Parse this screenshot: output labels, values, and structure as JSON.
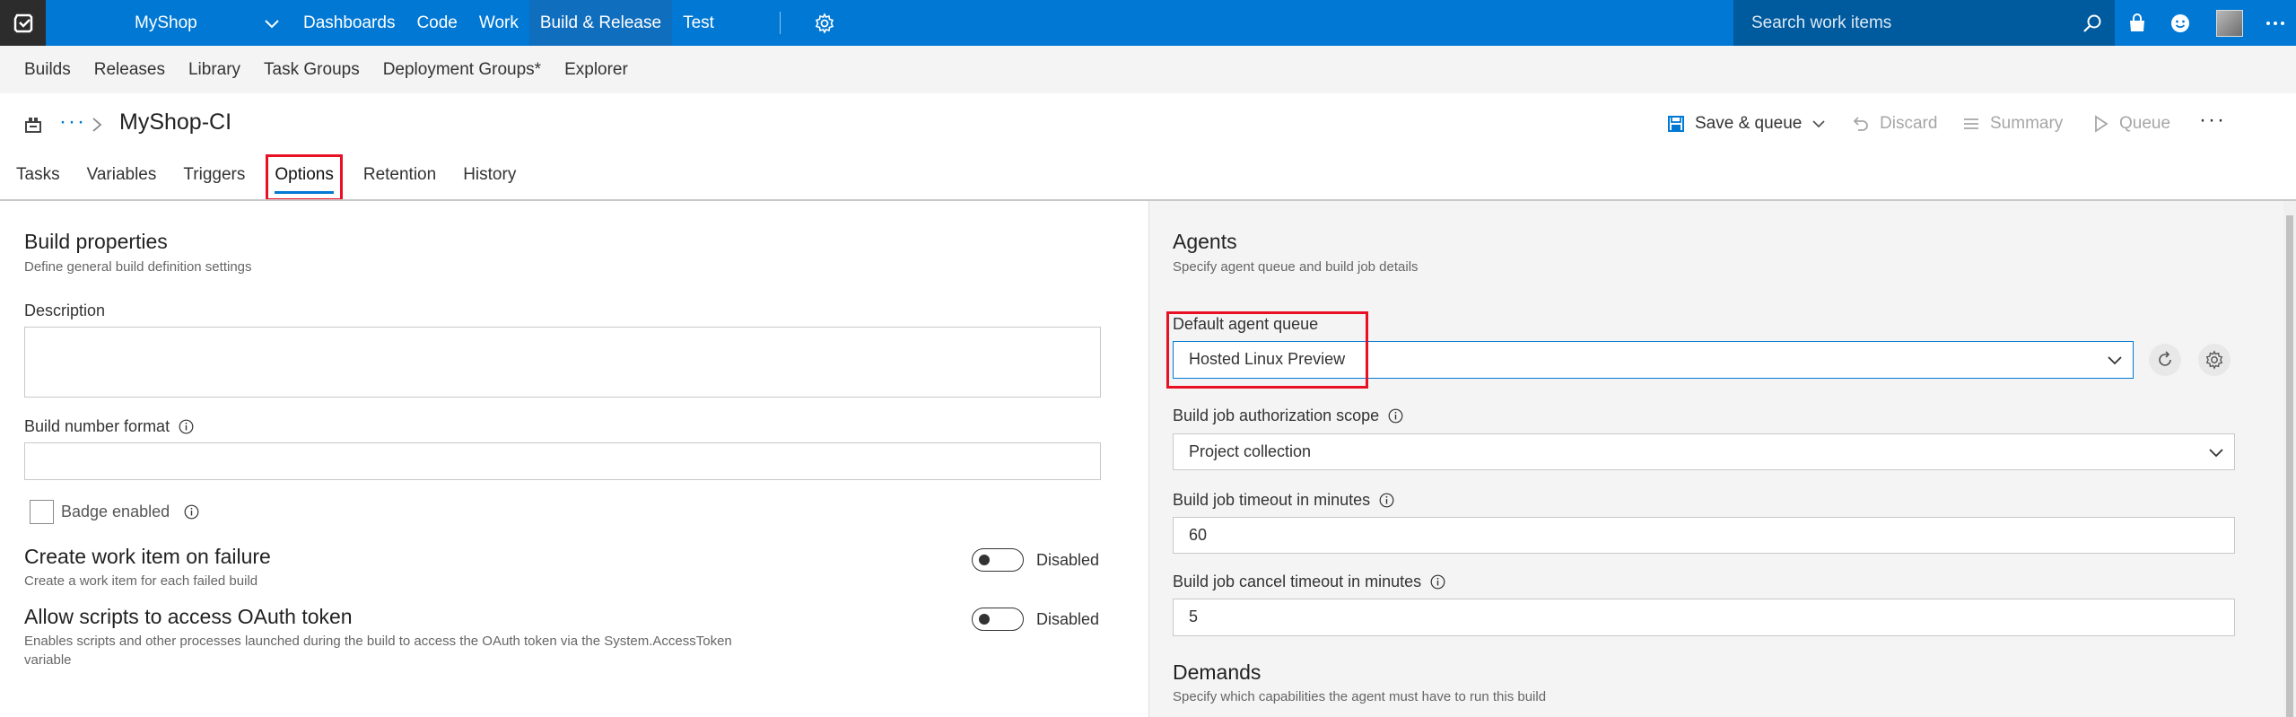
{
  "topbar": {
    "project": "MyShop",
    "nav": [
      "Dashboards",
      "Code",
      "Work",
      "Build & Release",
      "Test"
    ],
    "active_nav": "Build & Release",
    "search_placeholder": "Search work items"
  },
  "subnav": [
    "Builds",
    "Releases",
    "Library",
    "Task Groups",
    "Deployment Groups*",
    "Explorer"
  ],
  "header": {
    "breadcrumb_dots": "···",
    "title": "MyShop-CI",
    "actions": {
      "save": "Save & queue",
      "discard": "Discard",
      "summary": "Summary",
      "queue": "Queue",
      "more": "···"
    }
  },
  "tabs": [
    "Tasks",
    "Variables",
    "Triggers",
    "Options",
    "Retention",
    "History"
  ],
  "active_tab": "Options",
  "left": {
    "title": "Build properties",
    "subtitle": "Define general build definition settings",
    "description_label": "Description",
    "description_value": "",
    "build_number_label": "Build number format",
    "build_number_value": "",
    "badge_label": "Badge enabled",
    "badge_checked": false,
    "work_item": {
      "title": "Create work item on failure",
      "subtitle": "Create a work item for each failed build",
      "state": "Disabled"
    },
    "oauth": {
      "title": "Allow scripts to access OAuth token",
      "subtitle_1": "Enables scripts and other processes launched during the build to access the OAuth token via the System.AccessToken",
      "subtitle_2": "variable",
      "state": "Disabled"
    }
  },
  "right": {
    "title": "Agents",
    "subtitle": "Specify agent queue and build job details",
    "queue_label": "Default agent queue",
    "queue_value": "Hosted Linux Preview",
    "auth_label": "Build job authorization scope",
    "auth_value": "Project collection",
    "timeout_label": "Build job timeout in minutes",
    "timeout_value": "60",
    "cancel_label": "Build job cancel timeout in minutes",
    "cancel_value": "5",
    "demands_title": "Demands",
    "demands_subtitle": "Specify which capabilities the agent must have to run this build"
  },
  "colors": {
    "brand_blue": "#0078d4",
    "highlight_red": "#e81123"
  }
}
